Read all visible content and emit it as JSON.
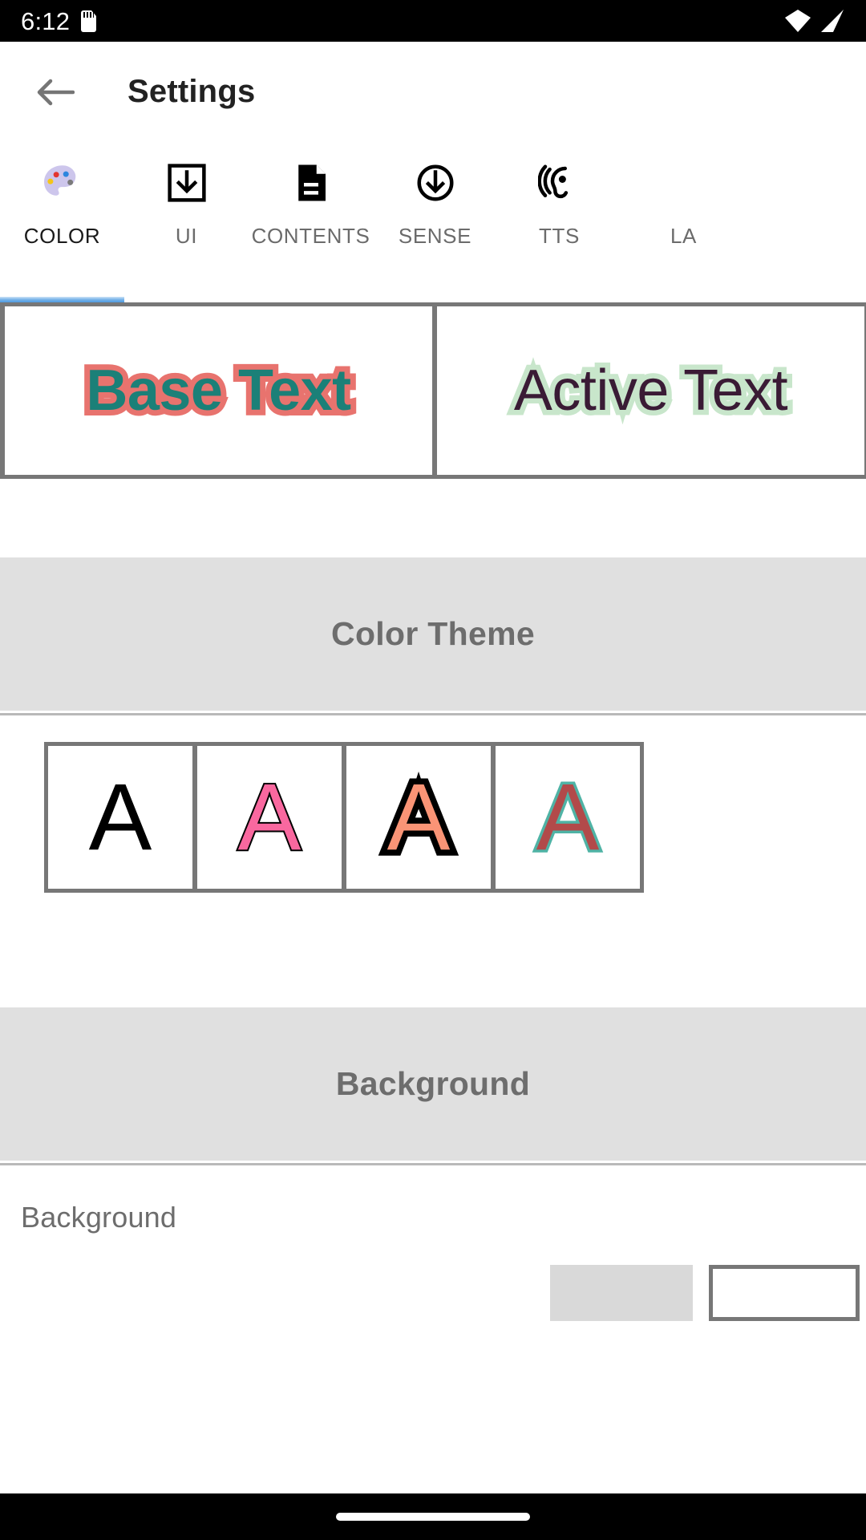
{
  "status_bar": {
    "clock": "6:12",
    "sd_card_icon": "sd-card-icon",
    "wifi_icon": "wifi-icon",
    "signal_icon": "cellular-signal-icon"
  },
  "app_bar": {
    "back_icon": "back-arrow-icon",
    "title": "Settings"
  },
  "tabs": {
    "active_index": 0,
    "items": [
      {
        "label": "COLOR",
        "icon": "palette-icon"
      },
      {
        "label": "UI",
        "icon": "download-box-icon"
      },
      {
        "label": "CONTENTS",
        "icon": "document-icon"
      },
      {
        "label": "SENSE",
        "icon": "download-circle-icon"
      },
      {
        "label": "TTS",
        "icon": "hearing-ear-icon"
      },
      {
        "label": "LA",
        "icon": "language-icon"
      }
    ]
  },
  "preview": {
    "base": {
      "text": "Base Text",
      "fill_color": "#1b8078",
      "outline_color": "#e8736e"
    },
    "active": {
      "text": "Active Text",
      "fill_color": "#3a1b35",
      "outline_color": "#c8e6cb"
    }
  },
  "color_theme_section": {
    "title": "Color Theme",
    "swatches": [
      {
        "glyph": "A",
        "fill_color": "#000000",
        "outline_color": "#000000"
      },
      {
        "glyph": "A",
        "fill_color": "#f9689f",
        "outline_color": "#000000"
      },
      {
        "glyph": "A",
        "fill_color": "#fa9476",
        "outline_color": "#000000"
      },
      {
        "glyph": "A",
        "fill_color": "#b24a4a",
        "outline_color": "#4fb3a5"
      }
    ]
  },
  "background_section": {
    "title": "Background",
    "row_label": "Background"
  },
  "colors": {
    "accent": "#4e9ae0",
    "band": "#e0e0e0",
    "frame": "#777777",
    "muted_text": "#6d6d6d"
  }
}
